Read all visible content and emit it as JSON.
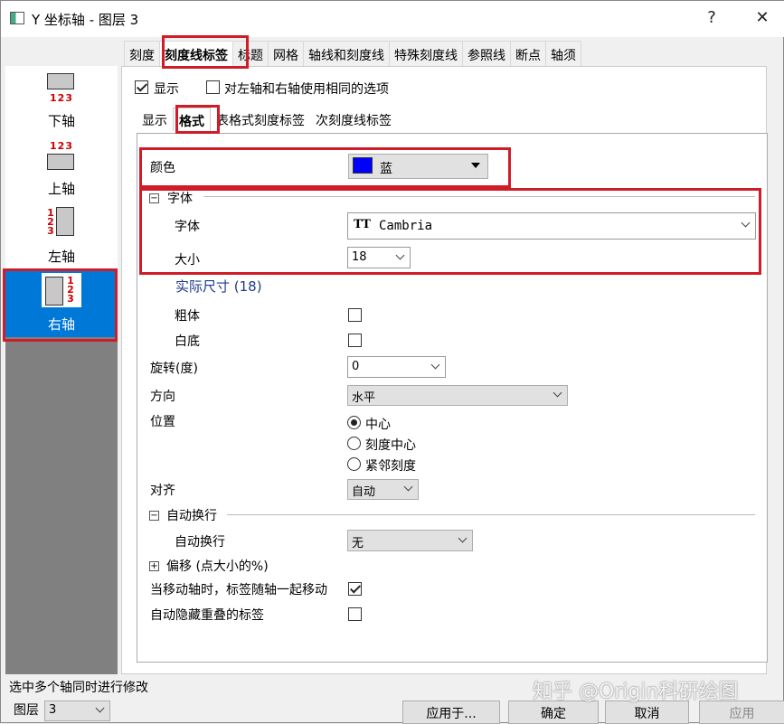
{
  "window": {
    "title": "Y 坐标轴 - 图层 3",
    "help": "?",
    "close": "✕"
  },
  "tabs": [
    "刻度",
    "刻度线标签",
    "标题",
    "网格",
    "轴线和刻度线",
    "特殊刻度线",
    "参照线",
    "断点",
    "轴须"
  ],
  "axes": [
    {
      "label": "下轴",
      "nums": "123"
    },
    {
      "label": "上轴",
      "nums": "123"
    },
    {
      "label": "左轴",
      "nums": "123"
    },
    {
      "label": "右轴",
      "nums": "123"
    }
  ],
  "top_options": {
    "show": "显示",
    "same_lr": "对左轴和右轴使用相同的选项"
  },
  "subtabs": [
    "显示",
    "格式",
    "表格式刻度标签",
    "次刻度线标签"
  ],
  "format": {
    "color_label": "颜色",
    "color_value": "蓝",
    "color_hex": "#0000ff",
    "font_section": "字体",
    "font_label": "字体",
    "font_value": "Cambria",
    "font_icon": "truetype-icon",
    "size_label": "大小",
    "size_value": "18",
    "actual_size": "实际尺寸 (18)",
    "bold_label": "粗体",
    "white_bg_label": "白底",
    "rotation_label": "旋转(度)",
    "rotation_value": "0",
    "direction_label": "方向",
    "direction_value": "水平",
    "position_label": "位置",
    "position_options": [
      "中心",
      "刻度中心",
      "紧邻刻度"
    ],
    "align_label": "对齐",
    "align_value": "自动",
    "wrap_section": "自动换行",
    "wrap_label": "自动换行",
    "wrap_value": "无",
    "offset_section": "偏移 (点大小的%)",
    "move_with_axis": "当移动轴时，标签随轴一起移动",
    "auto_hide": "自动隐藏重叠的标签"
  },
  "footer": {
    "status": "选中多个轴同时进行修改",
    "layer_label": "图层",
    "layer_value": "3",
    "apply_to": "应用于...",
    "ok": "确定",
    "cancel": "取消",
    "apply": "应用"
  },
  "watermark": "知乎 @Origin科研绘图",
  "colors": {
    "highlight": "#d01c28",
    "selection": "#0078d7"
  }
}
